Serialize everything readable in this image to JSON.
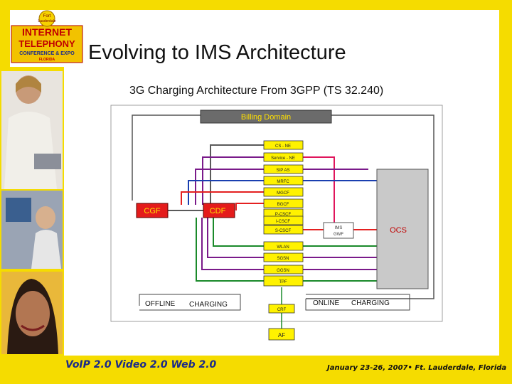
{
  "slide": {
    "title": "Evolving to IMS Architecture",
    "subtitle": "3G Charging Architecture From 3GPP (TS 32.240)"
  },
  "logo": {
    "line1": "Fort",
    "line2": "Lauderdale",
    "line3": "INTERNET",
    "line4": "TELEPHONY",
    "line5": "CONFERENCE & EXPO",
    "line6": "FLORIDA"
  },
  "diagram": {
    "billing_domain": "Billing Domain",
    "cgf": "CGF",
    "cdf": "CDF",
    "ocs": "OCS",
    "ims_gwf": [
      "IMS",
      "GWF"
    ],
    "offline": "OFFLINE",
    "offline_charging": "CHARGING",
    "online": "ONLINE",
    "online_charging": "CHARGING",
    "nodes": [
      "CS - NE",
      "Service - NE",
      "SIP AS",
      "MRFC",
      "MGCF",
      "BGCF",
      "P-CSCF",
      "I-CSCF",
      "S-CSCF",
      "WLAN",
      "SGSN",
      "GGSN",
      "TPF",
      "CRF",
      "AF"
    ]
  },
  "footer": {
    "left": "VoIP 2.0  Video 2.0  Web 2.0",
    "right": "January 23-26, 2007• Ft. Lauderdale, Florida"
  },
  "colors": {
    "background": "#f5dc00",
    "node_fill": "#fff200",
    "cgf_fill": "#e41b1b",
    "cdf_fill": "#e41b1b",
    "ocs_fill": "#c9c9c9",
    "billing_fill": "#6b6b6b"
  }
}
